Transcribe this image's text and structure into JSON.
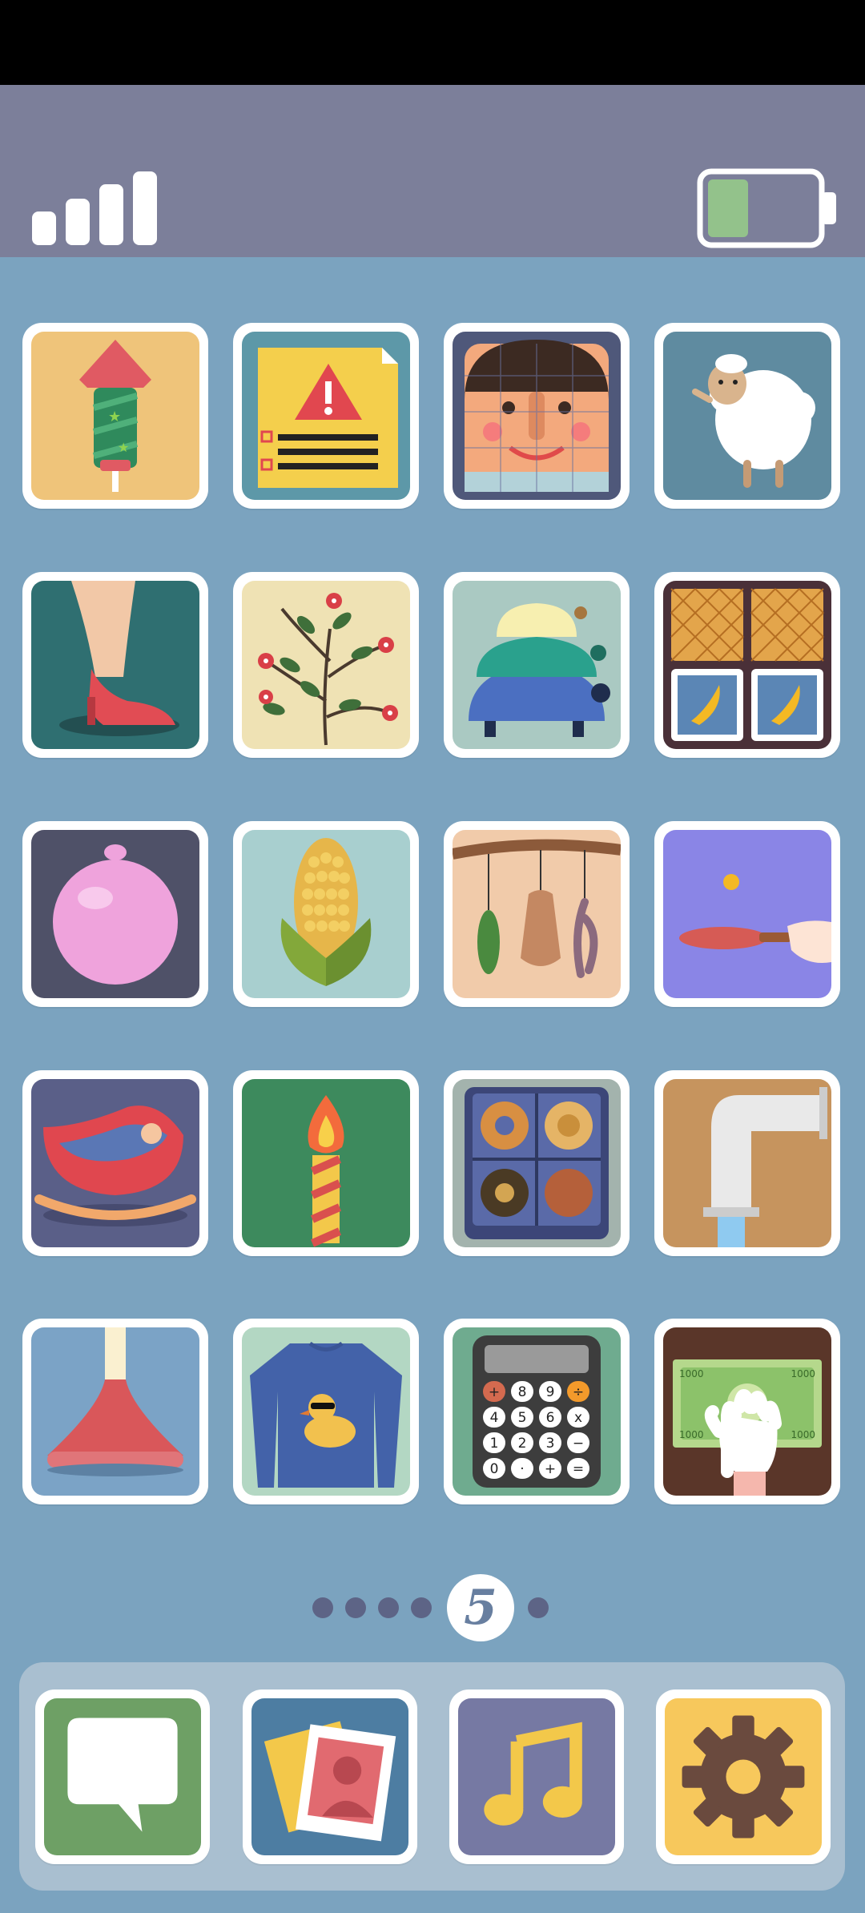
{
  "status": {
    "signal_bars": 4,
    "battery_level": 0.38,
    "battery_color": "#93c28b"
  },
  "grid": {
    "rows": [
      [
        "firework-rocket-app",
        "warning-document-app",
        "puzzle-face-app",
        "sheep-app"
      ],
      [
        "high-heel-shoe-app",
        "flower-branch-app",
        "stacked-turtles-app",
        "slot-machine-app"
      ],
      [
        "balloon-app",
        "corn-app",
        "hanging-shells-app",
        "ping-pong-app"
      ],
      [
        "cradle-app",
        "candle-app",
        "cookie-box-app",
        "faucet-app"
      ],
      [
        "plunger-app",
        "duck-sweater-app",
        "calculator-app",
        "money-counting-app"
      ]
    ],
    "calculator_keys": [
      "+",
      "8",
      "9",
      "÷",
      "4",
      "5",
      "6",
      "x",
      "1",
      "2",
      "3",
      "−",
      "0",
      "·",
      "+",
      "="
    ],
    "banknote_values": [
      "1000",
      "1000",
      "1000",
      "1000"
    ]
  },
  "pagination": {
    "current_page": "5",
    "total_dots": 6
  },
  "dock": {
    "apps": [
      "messages-app",
      "photos-app",
      "music-app",
      "settings-app"
    ]
  },
  "colors": {
    "background": "#7ba3bf",
    "status_bar": "#7c7f9a",
    "dock": "#a9bfd0"
  }
}
